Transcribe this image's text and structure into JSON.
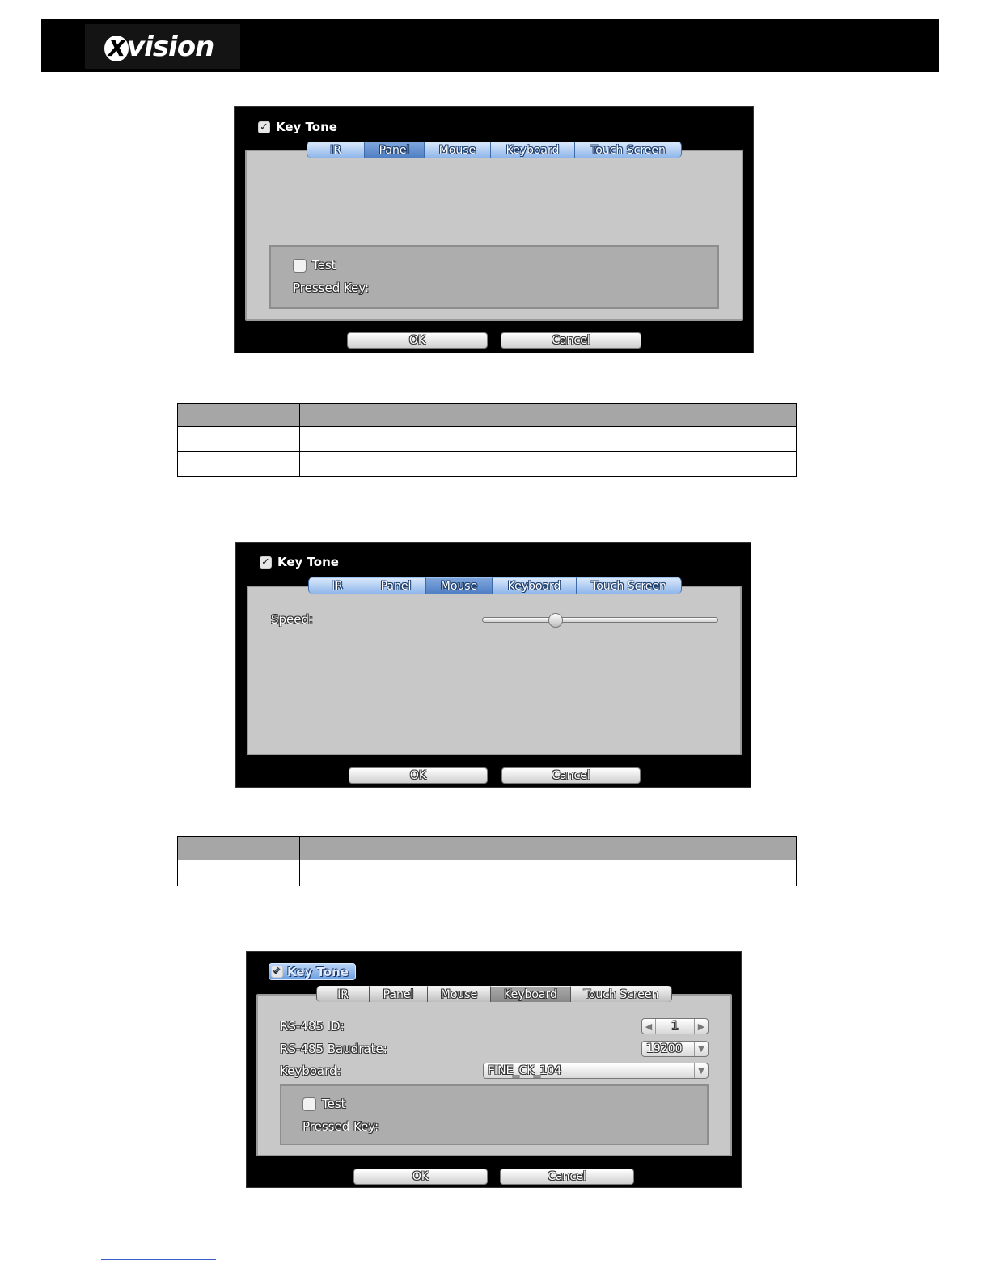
{
  "header": {
    "logo_text": "vision",
    "logo_mark": "X"
  },
  "dialogs": [
    {
      "key_tone": "Key Tone",
      "tabs": [
        "IR",
        "Panel",
        "Mouse",
        "Keyboard",
        "Touch Screen"
      ],
      "active_tab": "Panel",
      "test_label": "Test",
      "pressed_key_label": "Pressed Key:",
      "ok": "OK",
      "cancel": "Cancel"
    },
    {
      "key_tone": "Key Tone",
      "tabs": [
        "IR",
        "Panel",
        "Mouse",
        "Keyboard",
        "Touch Screen"
      ],
      "active_tab": "Mouse",
      "speed_label": "Speed:",
      "speed_level": 0.31,
      "ok": "OK",
      "cancel": "Cancel"
    },
    {
      "key_tone": "Key Tone",
      "tabs": [
        "IR",
        "Panel",
        "Mouse",
        "Keyboard",
        "Touch Screen"
      ],
      "active_tab": "Keyboard",
      "rs485_id_label": "RS-485 ID:",
      "rs485_id_value": "1",
      "rs485_baud_label": "RS-485 Baudrate:",
      "rs485_baud_value": "19200",
      "keyboard_label": "Keyboard:",
      "keyboard_value": "FINE_CK_104",
      "test_label": "Test",
      "pressed_key_label": "Pressed Key:",
      "ok": "OK",
      "cancel": "Cancel"
    }
  ],
  "icons": {
    "check": "check-icon",
    "left": "chevron-left-icon",
    "right": "chevron-right-icon",
    "down": "chevron-down-icon"
  }
}
